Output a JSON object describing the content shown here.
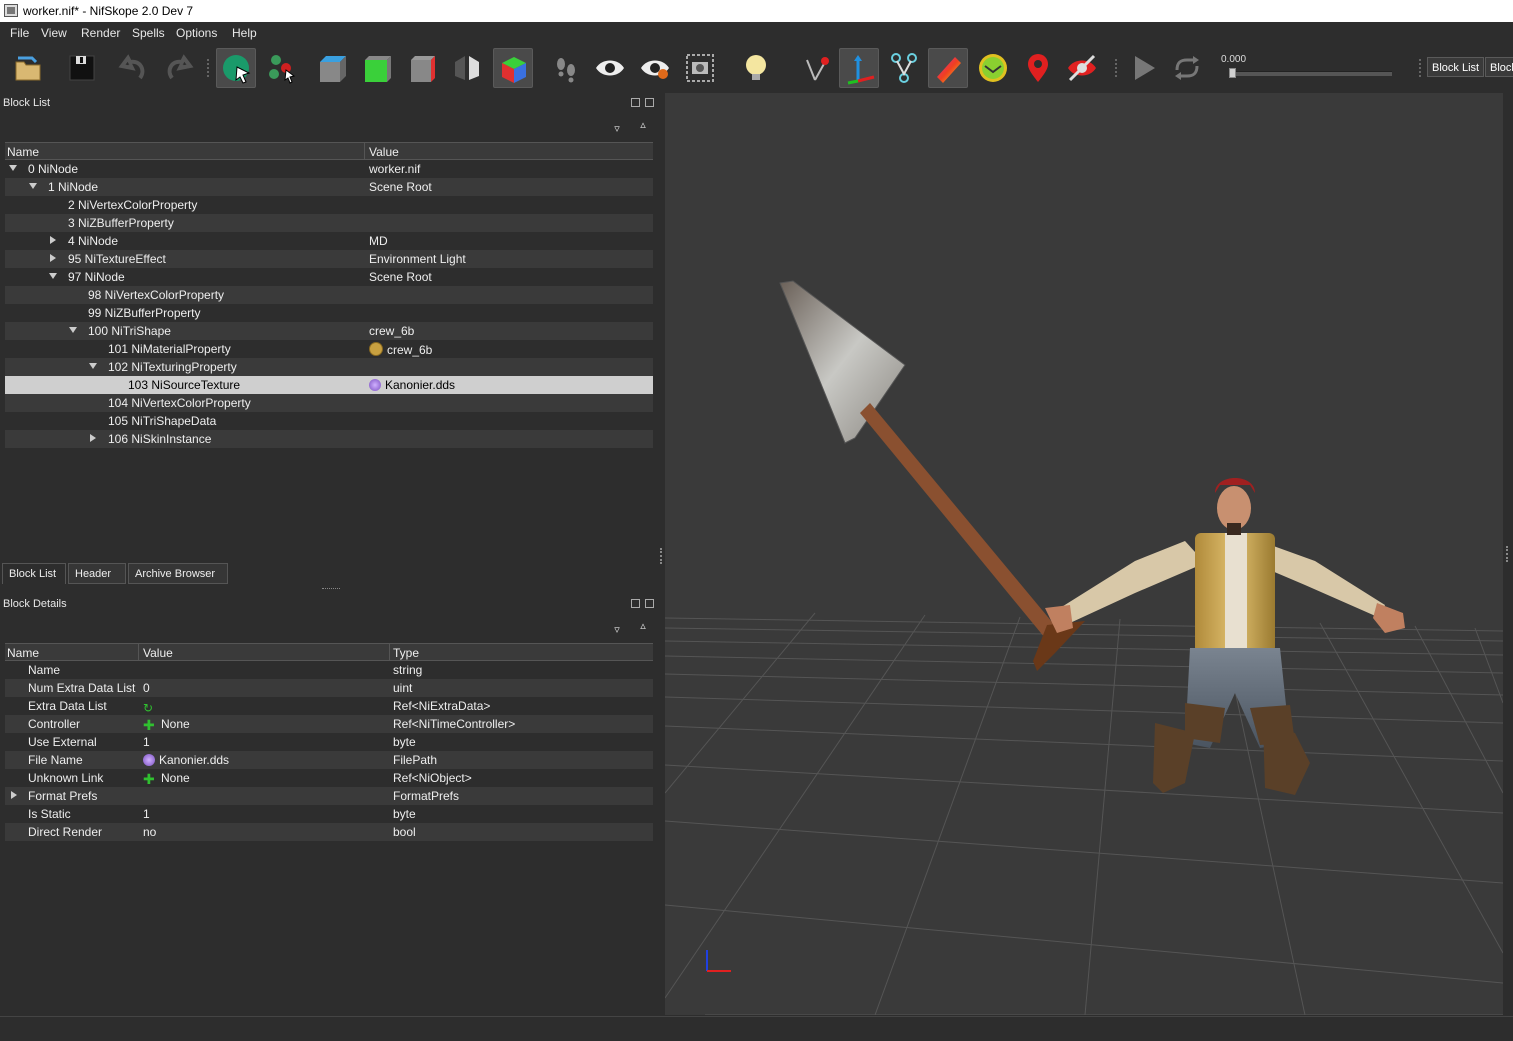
{
  "window": {
    "title": "worker.nif* - NifSkope 2.0 Dev 7"
  },
  "menu": [
    "File",
    "View",
    "Render",
    "Spells",
    "Options",
    "Help"
  ],
  "toolbar": {
    "time_value": "0.000",
    "time_slider_fraction": 0.0,
    "dock_buttons": [
      "Block List",
      "Block"
    ]
  },
  "block_list": {
    "title": "Block List",
    "columns": {
      "name": "Name",
      "value": "Value"
    },
    "rows": [
      {
        "name": "0 NiNode",
        "value": "worker.nif",
        "depth": 0,
        "expander": "down"
      },
      {
        "name": "1 NiNode",
        "value": "Scene Root",
        "depth": 1,
        "expander": "down"
      },
      {
        "name": "2 NiVertexColorProperty",
        "value": "",
        "depth": 2,
        "expander": "none"
      },
      {
        "name": "3 NiZBufferProperty",
        "value": "",
        "depth": 2,
        "expander": "none"
      },
      {
        "name": "4 NiNode",
        "value": "MD",
        "depth": 2,
        "expander": "right"
      },
      {
        "name": "95 NiTextureEffect",
        "value": "Environment Light",
        "depth": 2,
        "expander": "right"
      },
      {
        "name": "97 NiNode",
        "value": "Scene Root",
        "depth": 2,
        "expander": "down"
      },
      {
        "name": "98 NiVertexColorProperty",
        "value": "",
        "depth": 3,
        "expander": "none"
      },
      {
        "name": "99 NiZBufferProperty",
        "value": "",
        "depth": 3,
        "expander": "none"
      },
      {
        "name": "100 NiTriShape",
        "value": "crew_6b",
        "depth": 3,
        "expander": "down"
      },
      {
        "name": "101 NiMaterialProperty",
        "value": "crew_6b",
        "depth": 4,
        "expander": "none",
        "icon": "palette-icon"
      },
      {
        "name": "102 NiTexturingProperty",
        "value": "",
        "depth": 4,
        "expander": "down"
      },
      {
        "name": "103 NiSourceTexture",
        "value": "Kanonier.dds",
        "depth": 5,
        "expander": "none",
        "icon": "texture-icon",
        "selected": true
      },
      {
        "name": "104 NiVertexColorProperty",
        "value": "",
        "depth": 4,
        "expander": "none"
      },
      {
        "name": "105 NiTriShapeData",
        "value": "",
        "depth": 4,
        "expander": "none"
      },
      {
        "name": "106 NiSkinInstance",
        "value": "",
        "depth": 4,
        "expander": "right"
      }
    ]
  },
  "tabs": [
    "Block List",
    "Header",
    "Archive Browser"
  ],
  "block_details": {
    "title": "Block Details",
    "columns": {
      "name": "Name",
      "value": "Value",
      "type": "Type"
    },
    "rows": [
      {
        "name": "Name",
        "value": "",
        "type": "string"
      },
      {
        "name": "Num Extra Data List",
        "value": "0",
        "type": "uint"
      },
      {
        "name": "Extra Data List",
        "value": "",
        "type": "Ref<NiExtraData>",
        "icon": "refresh-icon"
      },
      {
        "name": "Controller",
        "value": "None",
        "type": "Ref<NiTimeController>",
        "icon": "plus-icon"
      },
      {
        "name": "Use External",
        "value": "1",
        "type": "byte"
      },
      {
        "name": "File Name",
        "value": "Kanonier.dds",
        "type": "FilePath",
        "icon": "texture-icon"
      },
      {
        "name": "Unknown Link",
        "value": "None",
        "type": "Ref<NiObject>",
        "icon": "plus-icon"
      },
      {
        "name": "Format Prefs",
        "value": "",
        "type": "FormatPrefs",
        "expander": "right"
      },
      {
        "name": "Is Static",
        "value": "1",
        "type": "byte"
      },
      {
        "name": "Direct Render",
        "value": "no",
        "type": "bool"
      }
    ]
  },
  "colors": {
    "background": "#2d2d2d",
    "alt_row": "#3a3a3a",
    "selection": "#cfcfcf",
    "viewport": "#3a3a3a",
    "axis_x": "#e02020",
    "axis_y": "#2040e0"
  }
}
